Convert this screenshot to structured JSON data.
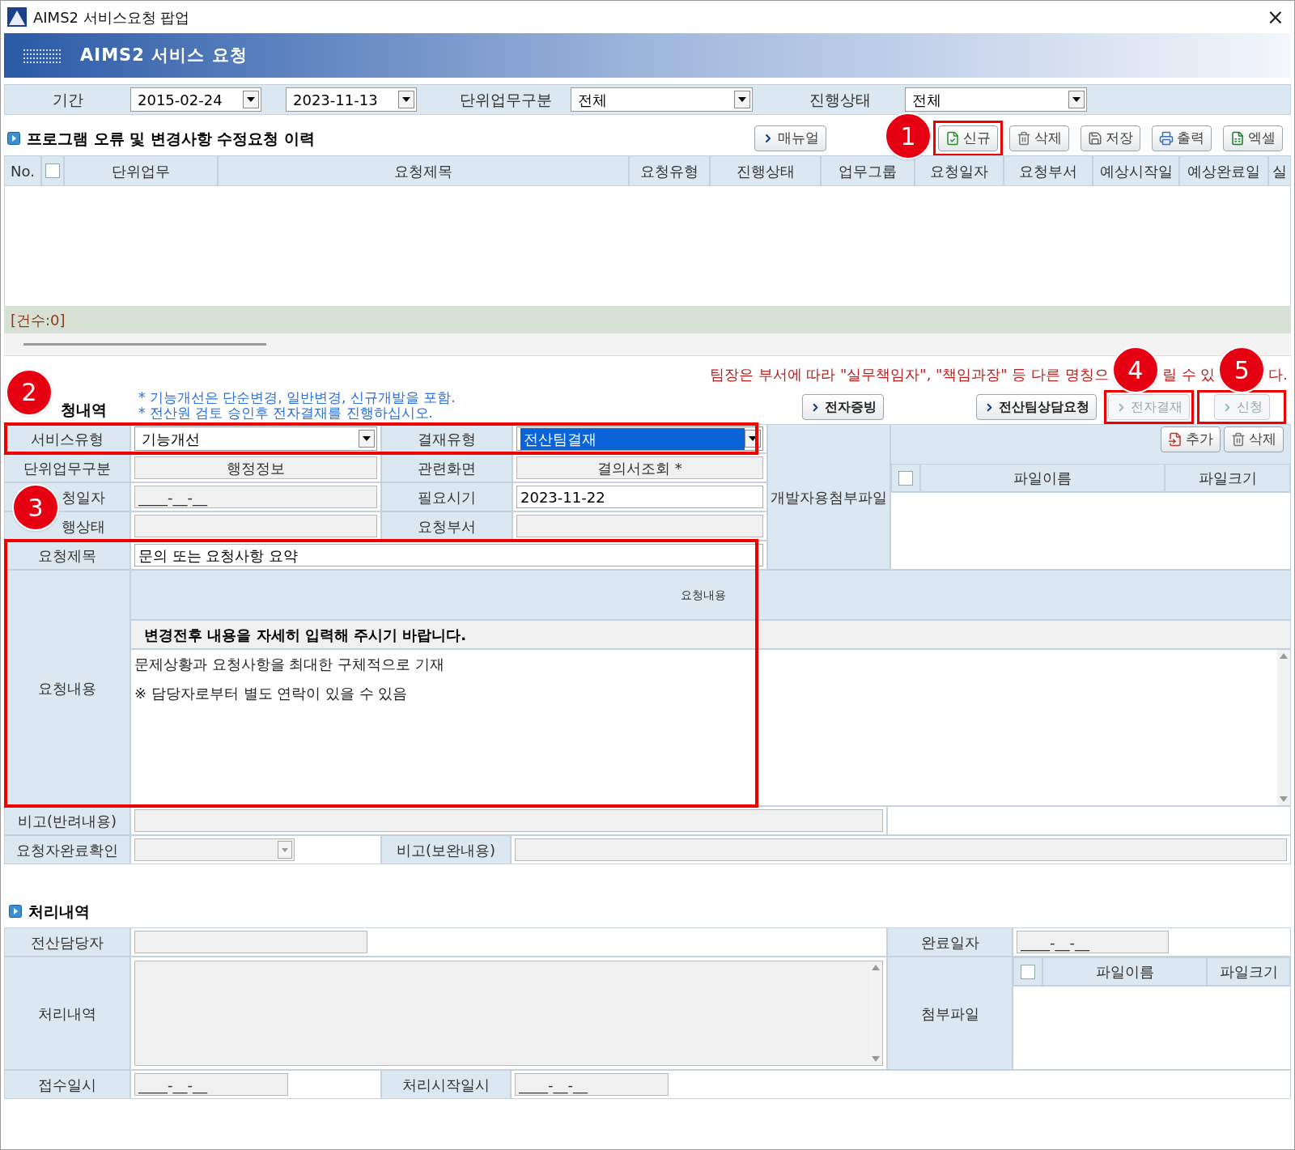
{
  "window": {
    "title": "AIMS2 서비스요청 팝업",
    "close": "×"
  },
  "banner": {
    "title": "AIMS2 서비스 요청"
  },
  "filters": [
    {
      "kind": "label",
      "text": "기간"
    },
    {
      "kind": "date",
      "value": "2015-02-24"
    },
    {
      "kind": "date",
      "value": "2023-11-13"
    },
    {
      "kind": "label",
      "text": "단위업무구분"
    },
    {
      "kind": "select",
      "value": "전체"
    },
    {
      "kind": "label",
      "text": "진행상태"
    },
    {
      "kind": "select",
      "value": "전체"
    }
  ],
  "history": {
    "title": "프로그램 오류 및 변경사항 수정요청 이력",
    "toolbar": [
      {
        "kind": "manual",
        "label": "매뉴얼"
      },
      {
        "kind": "callout",
        "label": "1"
      },
      {
        "kind": "new",
        "label": "신규",
        "highlighted": true
      },
      {
        "kind": "delete",
        "label": "삭제",
        "highlighted": false
      },
      {
        "kind": "save",
        "label": "저장",
        "highlighted": false
      },
      {
        "kind": "print",
        "label": "출력",
        "highlighted": false
      },
      {
        "kind": "excel",
        "label": "엑셀",
        "highlighted": false
      }
    ],
    "header_checkbox": {
      "checked": false
    },
    "columns": [
      "No.",
      "단위업무",
      "요청제목",
      "요청유형",
      "진행상태",
      "업무그룹",
      "요청일자",
      "요청부서",
      "예상시작일",
      "예상완료일",
      "실"
    ],
    "count": "[건수:0]"
  },
  "request": {
    "note": [
      {
        "kind": "text",
        "text": "팀장은 부서에 따라 \"실무책임자\", \"책임과장\" 등 다른 명칭으"
      },
      {
        "kind": "callout",
        "text": "4"
      },
      {
        "kind": "text",
        "text": "릴 수 있"
      },
      {
        "kind": "callout",
        "text": "5"
      },
      {
        "kind": "text",
        "text": "다."
      }
    ],
    "heading": [
      {
        "kind": "callout",
        "text": "2"
      },
      {
        "kind": "text",
        "text": "청내역"
      }
    ],
    "info": [
      "* 기능개선은 단순변경, 일반변경, 신규개발을 포함.",
      "* 전산원 검토 승인후 전자결재를 진행하십시오."
    ],
    "buttons": [
      {
        "label": "전자증빙",
        "disabled": false,
        "highlighted": false
      },
      {
        "label": "전산팀상담요청",
        "disabled": false,
        "highlighted": false
      },
      {
        "label": "전자결재",
        "disabled": true,
        "highlighted": true
      },
      {
        "label": "신청",
        "disabled": true,
        "highlighted": true
      }
    ]
  },
  "form": {
    "callout": "3",
    "highlights": [
      {
        "highlighted": true
      },
      {
        "highlighted": true
      }
    ],
    "rows": [
      {
        "cells": [
          {
            "kind": "label",
            "text": "서비스유형"
          },
          {
            "kind": "select",
            "value": "기능개선",
            "selected": false
          },
          {
            "kind": "label",
            "text": "결재유형"
          },
          {
            "kind": "select",
            "value": "전산팀결재",
            "selected": true
          }
        ]
      },
      {
        "cells": [
          {
            "kind": "label",
            "text": "단위업무구분"
          },
          {
            "kind": "display",
            "value": "행정정보"
          },
          {
            "kind": "label",
            "text": "관련화면"
          },
          {
            "kind": "display",
            "value": "결의서조회 *"
          }
        ]
      },
      {
        "cells": [
          {
            "kind": "cut-label",
            "text": "청일자"
          },
          {
            "kind": "field",
            "value": "____-__-__",
            "disabled": true
          },
          {
            "kind": "label",
            "text": "필요시기"
          },
          {
            "kind": "field",
            "value": "2023-11-22",
            "disabled": false
          }
        ]
      },
      {
        "cells": [
          {
            "kind": "cut-label",
            "text": "행상태"
          },
          {
            "kind": "field",
            "disabled": true
          },
          {
            "kind": "label",
            "text": "요청부서"
          },
          {
            "kind": "field",
            "disabled": true
          }
        ]
      },
      {
        "cells": [
          {
            "kind": "label",
            "text": "요청제목"
          },
          {
            "kind": "wide",
            "value": "문의 또는 요청사항 요약",
            "disabled": false
          }
        ]
      }
    ],
    "attachments": {
      "label": "개발자용첨부파일",
      "buttons": [
        {
          "kind": "add",
          "label": "추가"
        },
        {
          "kind": "delete",
          "label": "삭제"
        }
      ],
      "checked": false,
      "columns": [
        "파일이름",
        "파일크기"
      ]
    },
    "content": {
      "label": "요청내용",
      "header": "요청내용",
      "instruction": "변경전후 내용을 자세히 입력해 주시기 바랍니다.",
      "lines": [
        "문제상황과 요청사항을 최대한 구체적으로 기재",
        "※ 담당자로부터 별도 연락이 있을 수 있음"
      ]
    },
    "remark_label": "비고(반려내용)",
    "confirm_label": "요청자완료확인",
    "supplement_label": "비고(보완내용)"
  },
  "process": {
    "title": "처리내역",
    "manager_label": "전산담당자",
    "done_label": "완료일자",
    "done_value": "____-__-__",
    "detail_label": "처리내역",
    "file_label": "첨부파일",
    "file_checked": false,
    "file_columns": [
      "파일이름",
      "파일크기"
    ],
    "received_label": "접수일시",
    "received_value": "____-__-__",
    "start_label": "처리시작일시",
    "start_value": "____-__-__"
  }
}
